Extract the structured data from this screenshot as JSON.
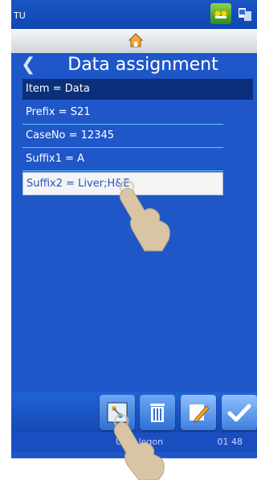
{
  "status": {
    "device_id": "TU",
    "icons": [
      "printer-status-icon",
      "network-icon"
    ]
  },
  "header": {
    "home_icon": "home-icon",
    "back_icon": "back-icon",
    "title": "Data assignment"
  },
  "list": {
    "header": "Item = Data",
    "items": [
      {
        "label": "Prefix = S21",
        "selected": false
      },
      {
        "label": "CaseNo = 12345",
        "selected": false
      },
      {
        "label": "Suffix1 = A",
        "selected": false
      },
      {
        "label": "Suffix2 = Liver;H&E",
        "selected": true
      }
    ]
  },
  "toolbar": {
    "buttons": [
      "assign-icon",
      "trash-icon",
      "edit-icon",
      "checkmark-icon"
    ]
  },
  "footer": {
    "user": "User logon",
    "time": "01 48"
  },
  "colors": {
    "background": "#1f57c9",
    "header_row": "#0b2f7a",
    "separator": "#5ac8ff",
    "selected_row": "#f4f4f4"
  }
}
